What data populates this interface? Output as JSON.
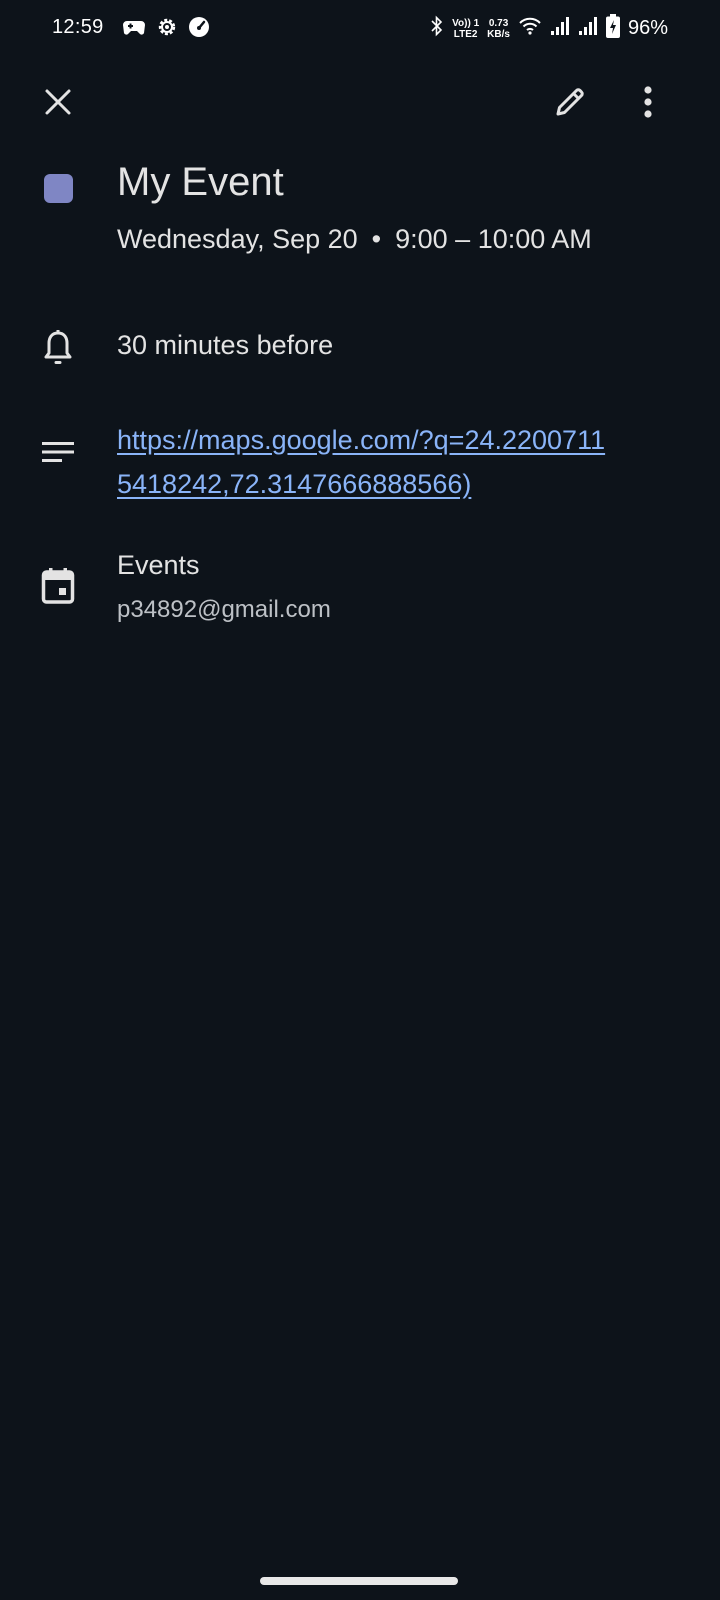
{
  "status_bar": {
    "time": "12:59",
    "network_top": "Vo)) 1",
    "network_bottom": "LTE2",
    "speed_value": "0.73",
    "speed_unit": "KB/s",
    "battery_percent": "96%",
    "icons": [
      "game-controller-icon",
      "settings-gear-icon",
      "speedometer-icon",
      "bluetooth-icon",
      "wifi-icon",
      "signal-1-icon",
      "signal-2-icon",
      "battery-charging-icon"
    ]
  },
  "toolbar": {
    "close_icon": "close-icon",
    "edit_icon": "edit-pencil-icon",
    "more_icon": "more-vert-icon"
  },
  "event": {
    "color": "#7f86c4",
    "title": "My Event",
    "date": "Wednesday, Sep 20",
    "separator": "•",
    "time_range": "9:00 – 10:00 AM"
  },
  "notification": {
    "icon": "bell-icon",
    "text": "30 minutes before"
  },
  "description": {
    "icon": "notes-icon",
    "link_text": "https://maps.google.com/?q=24.22007115418242,72.3147666888566)"
  },
  "calendar": {
    "icon": "calendar-icon",
    "name": "Events",
    "account": "p34892@gmail.com"
  },
  "colors": {
    "background": "#0d131a",
    "text_primary": "#e3e3e3",
    "text_secondary": "#bdc1c6",
    "link": "#8ab4f8"
  }
}
